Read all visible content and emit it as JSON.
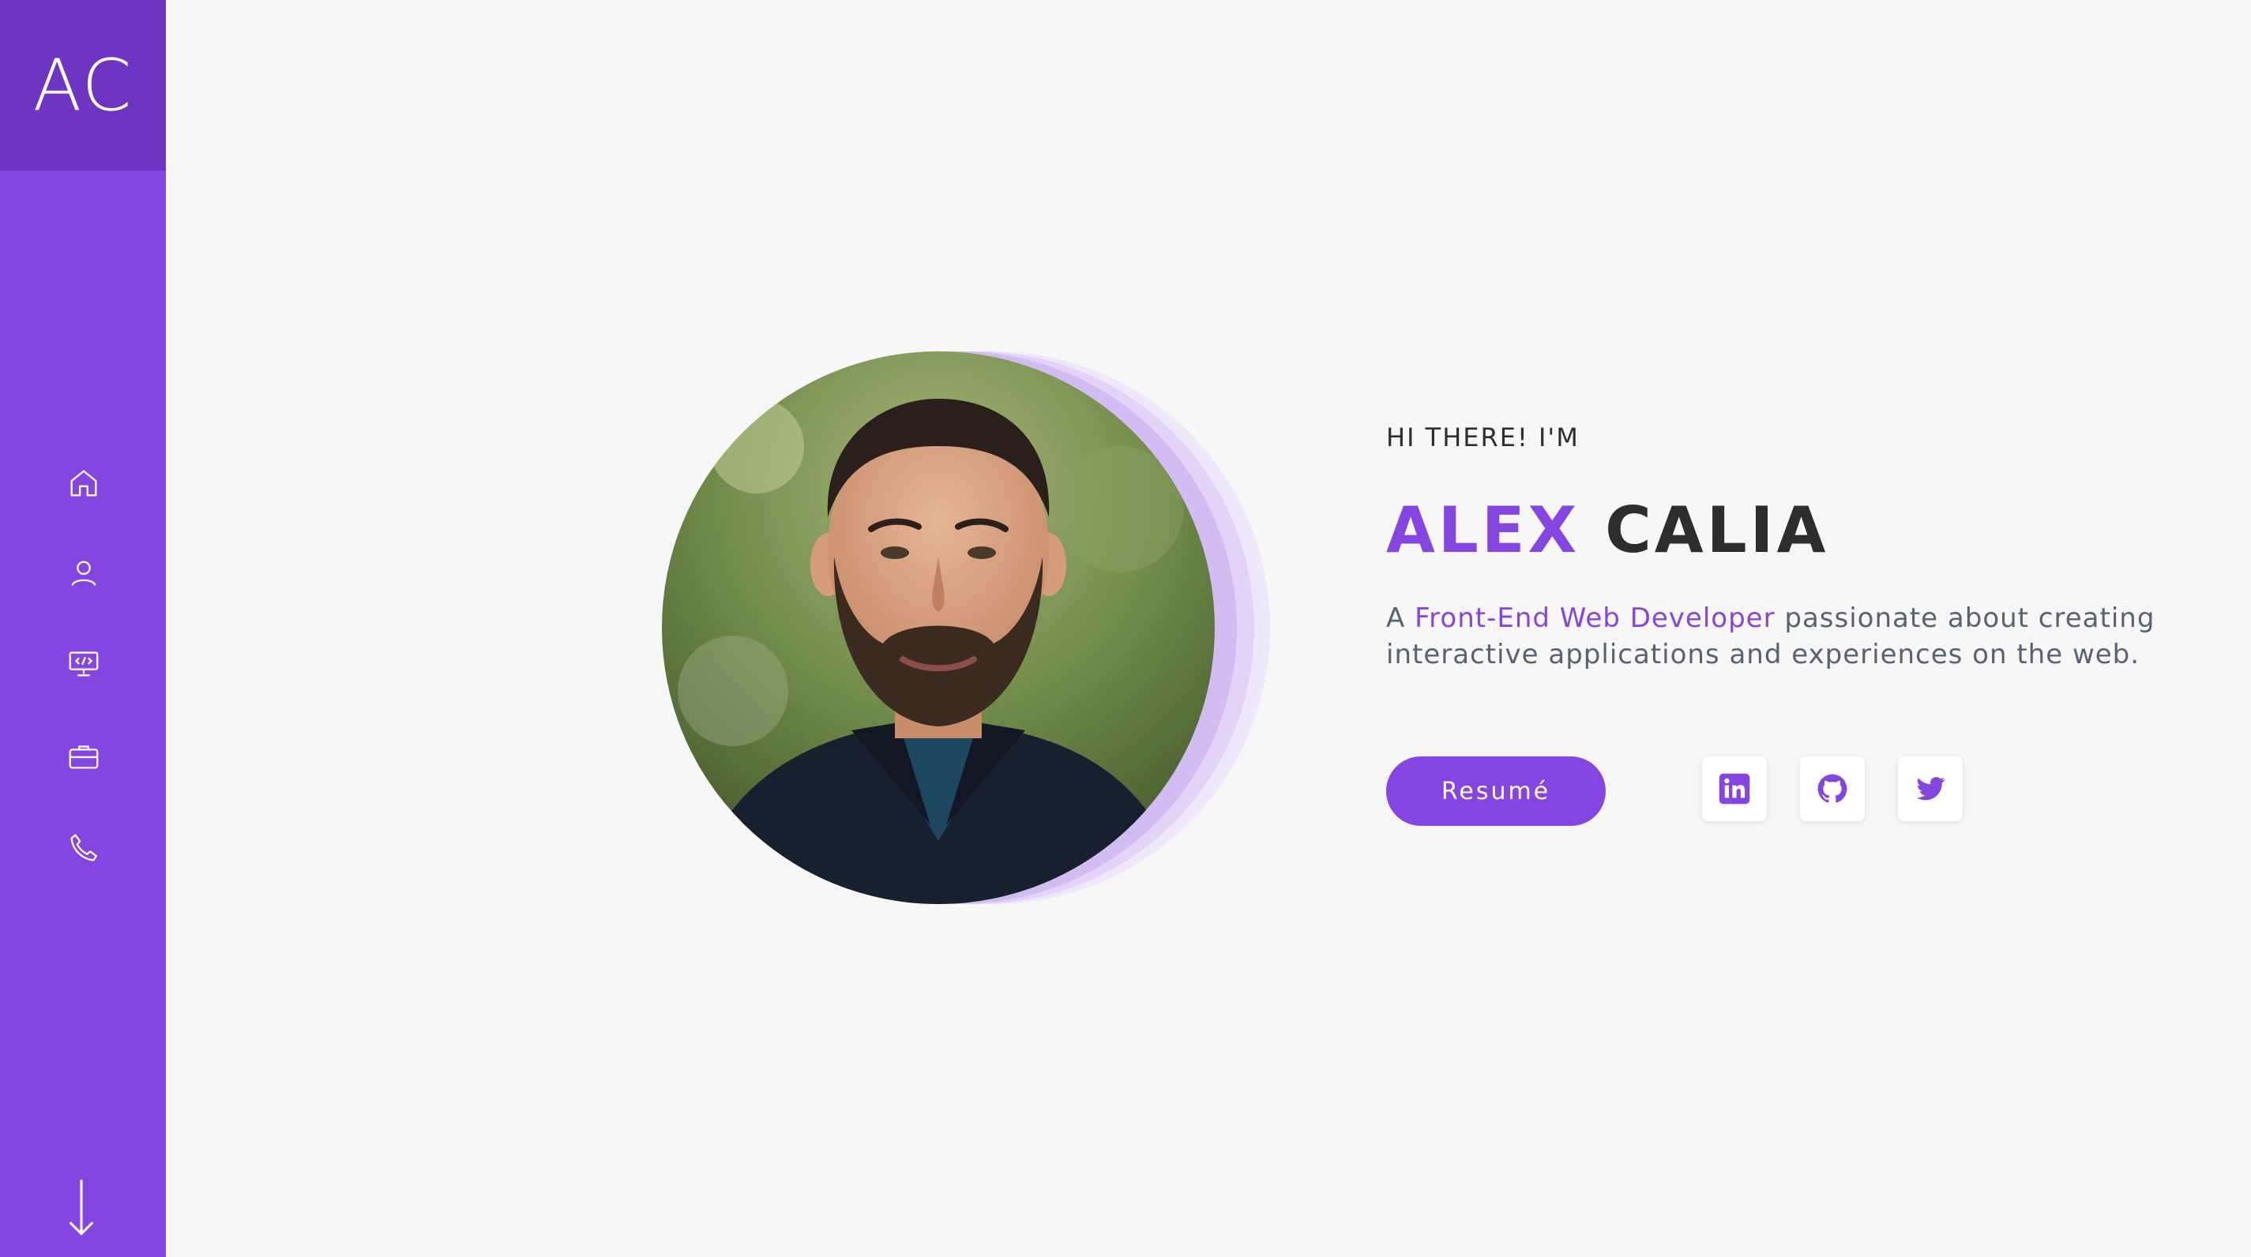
{
  "sidebar": {
    "logo_text": "AC",
    "nav": [
      {
        "icon": "home-icon"
      },
      {
        "icon": "user-icon"
      },
      {
        "icon": "code-monitor-icon"
      },
      {
        "icon": "briefcase-icon"
      },
      {
        "icon": "phone-icon"
      }
    ],
    "scroll_icon": "arrow-down-icon"
  },
  "hero": {
    "greeting": "HI THERE! I'M",
    "first_name": "ALEX",
    "last_name": "CALIA",
    "tagline_prefix": "A ",
    "tagline_highlight": "Front-End Web Developer",
    "tagline_suffix": " passionate about creating interactive applications and experiences on the web.",
    "resume_label": "Resumé",
    "social": [
      {
        "icon": "linkedin-icon"
      },
      {
        "icon": "github-icon"
      },
      {
        "icon": "twitter-icon"
      }
    ]
  },
  "colors": {
    "accent": "#8445e0",
    "accent_dark": "#6e34c2",
    "background": "#f7f7f7",
    "text_dark": "#2d2d2d",
    "text_muted": "#5a6272"
  }
}
